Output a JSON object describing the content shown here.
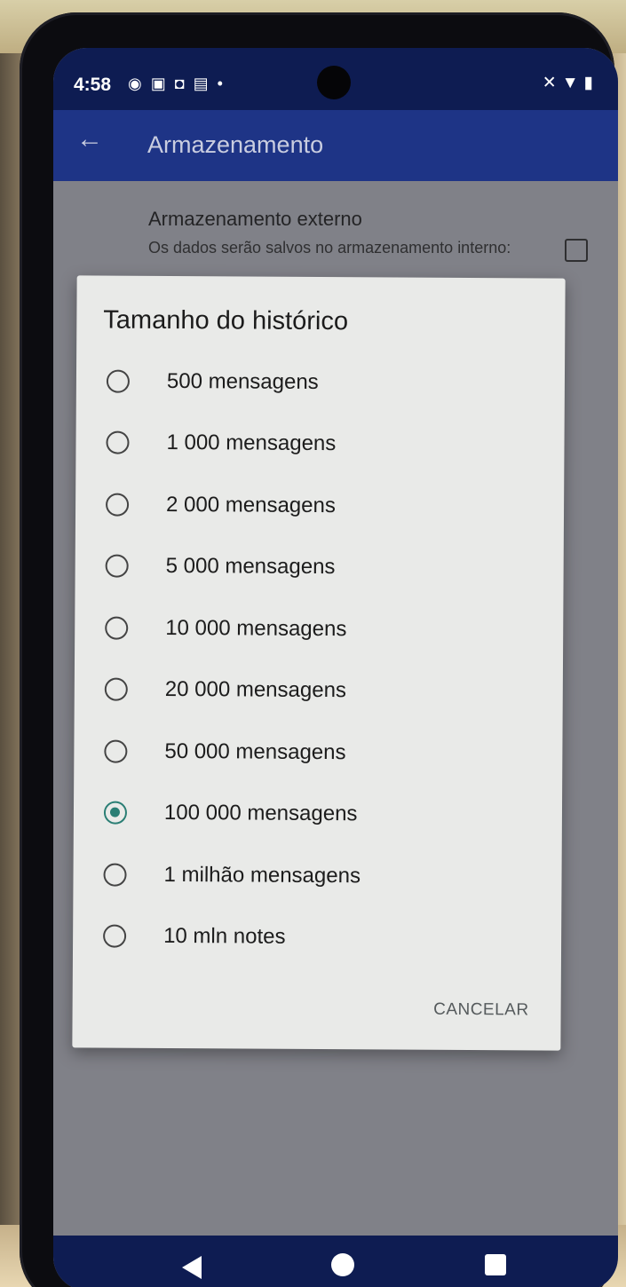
{
  "status_bar": {
    "time": "4:58",
    "left_icons": [
      "messenger-icon",
      "sim-icon",
      "shopping-icon",
      "chat-icon",
      "dot-icon"
    ],
    "right_icons": [
      "mute-icon",
      "wifi-icon",
      "battery-icon"
    ]
  },
  "app_bar": {
    "title": "Armazenamento"
  },
  "settings": {
    "external_storage_title": "Armazenamento externo",
    "external_storage_desc": "Os dados serão salvos no armazenamento interno:",
    "external_storage_checked": false
  },
  "dialog": {
    "title": "Tamanho do histórico",
    "options": [
      {
        "label": "500 mensagens",
        "selected": false
      },
      {
        "label": "1 000 mensagens",
        "selected": false
      },
      {
        "label": "2 000 mensagens",
        "selected": false
      },
      {
        "label": "5 000 mensagens",
        "selected": false
      },
      {
        "label": "10 000 mensagens",
        "selected": false
      },
      {
        "label": "20 000 mensagens",
        "selected": false
      },
      {
        "label": "50 000 mensagens",
        "selected": false
      },
      {
        "label": "100 000 mensagens",
        "selected": true
      },
      {
        "label": "1 milhão mensagens",
        "selected": false
      },
      {
        "label": "10 mln notes",
        "selected": false
      }
    ],
    "cancel_label": "CANCELAR"
  },
  "colors": {
    "status_bar": "#0e1c52",
    "app_bar": "#1e3486",
    "accent": "#2a7e74"
  }
}
